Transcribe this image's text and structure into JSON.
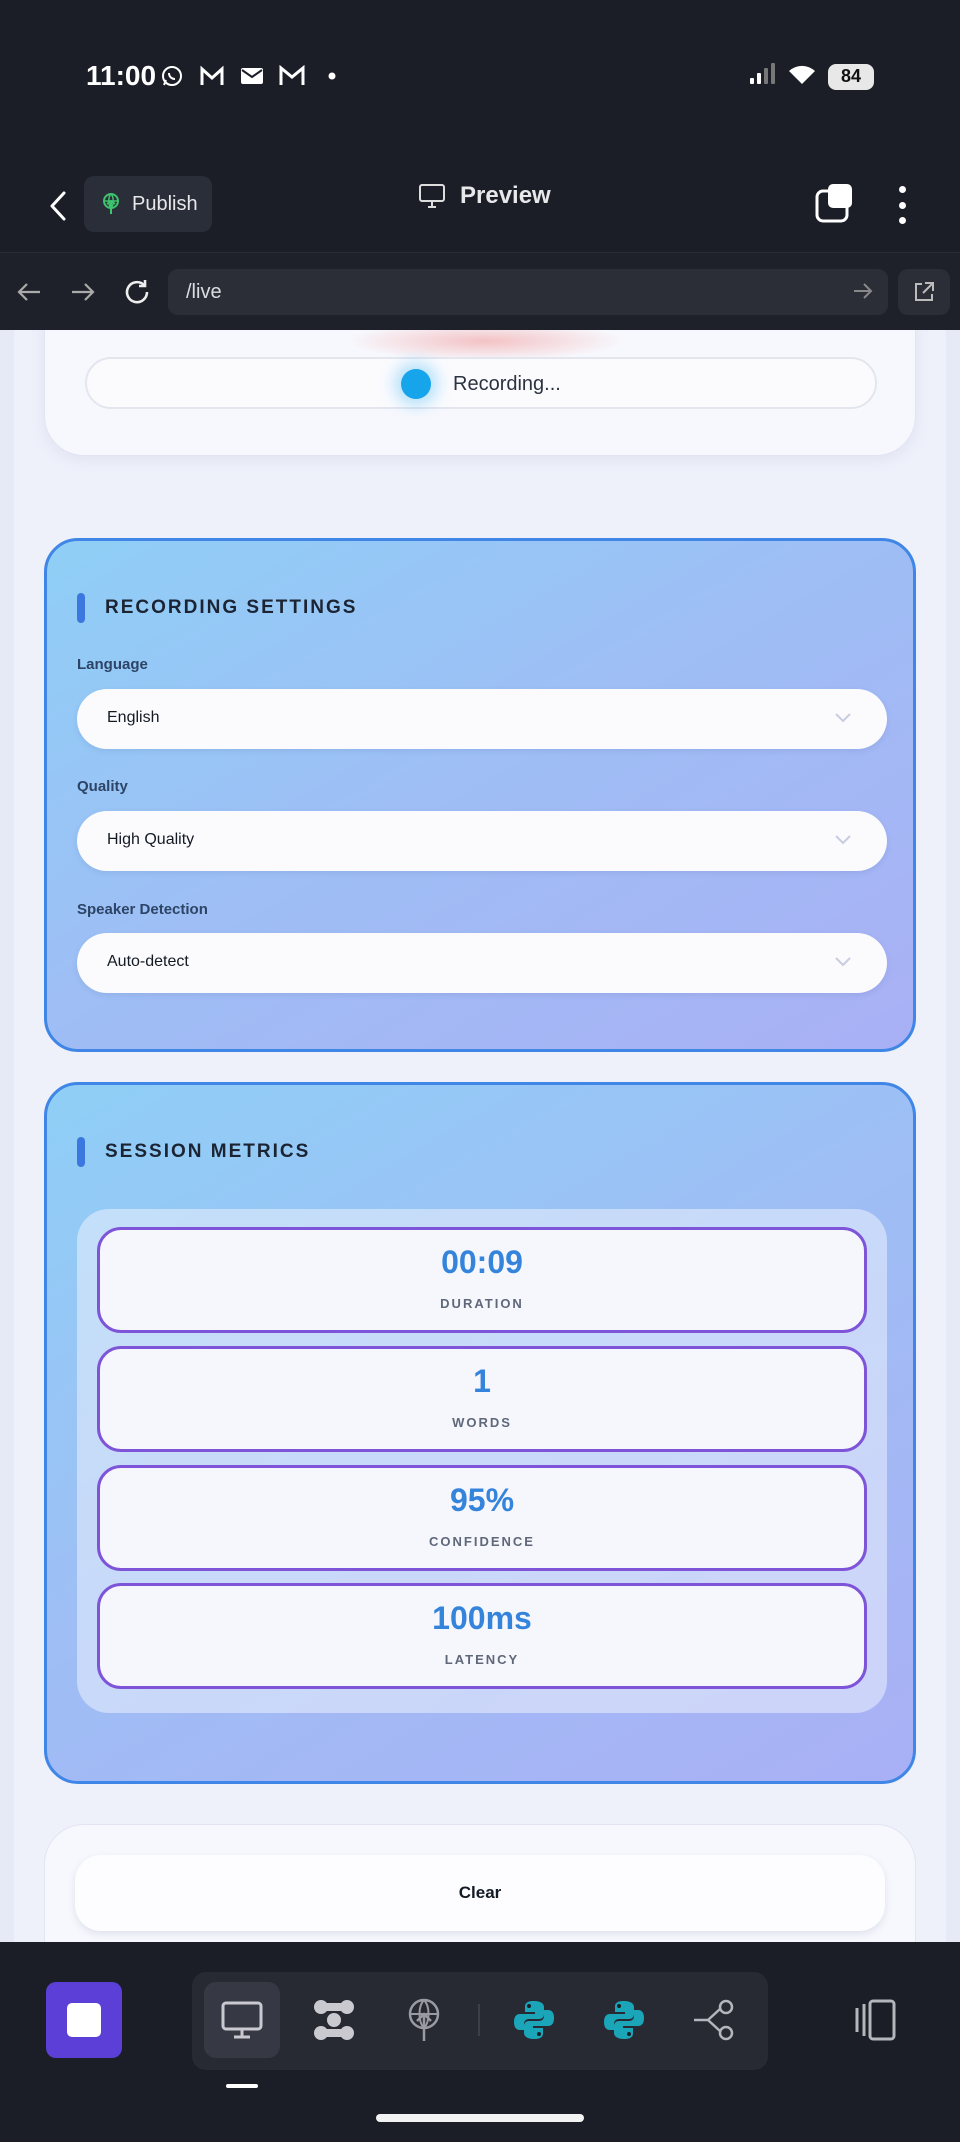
{
  "status_bar": {
    "time": "11:00",
    "battery": "84",
    "notification_icons": [
      "whatsapp-icon",
      "mail-m-icon",
      "mail-icon",
      "gmail-icon",
      "dot-icon"
    ],
    "system_icons": [
      "signal-icon",
      "wifi-icon",
      "battery-icon"
    ]
  },
  "app_bar": {
    "publish_label": "Publish",
    "preview_label": "Preview"
  },
  "browser": {
    "url": "/live"
  },
  "recording": {
    "status_text": "Recording..."
  },
  "settings": {
    "title": "RECORDING SETTINGS",
    "fields": [
      {
        "label": "Language",
        "value": "English"
      },
      {
        "label": "Quality",
        "value": "High Quality"
      },
      {
        "label": "Speaker Detection",
        "value": "Auto-detect"
      }
    ]
  },
  "metrics": {
    "title": "SESSION METRICS",
    "items": [
      {
        "value": "00:09",
        "label": "DURATION"
      },
      {
        "value": "1",
        "label": "WORDS"
      },
      {
        "value": "95%",
        "label": "CONFIDENCE"
      },
      {
        "value": "100ms",
        "label": "LATENCY"
      }
    ]
  },
  "actions": {
    "clear_label": "Clear"
  },
  "toolbar": {
    "tools": [
      "desktop-icon",
      "cluster-icon",
      "deploy-icon",
      "python-icon",
      "python-icon",
      "share-nodes-icon"
    ],
    "active_tool": "desktop-icon"
  },
  "colors": {
    "accent_blue": "#3584dc",
    "accent_purple": "#7e55d8",
    "stop_button": "#5b3fd6",
    "recording_dot": "#16a4ea"
  }
}
